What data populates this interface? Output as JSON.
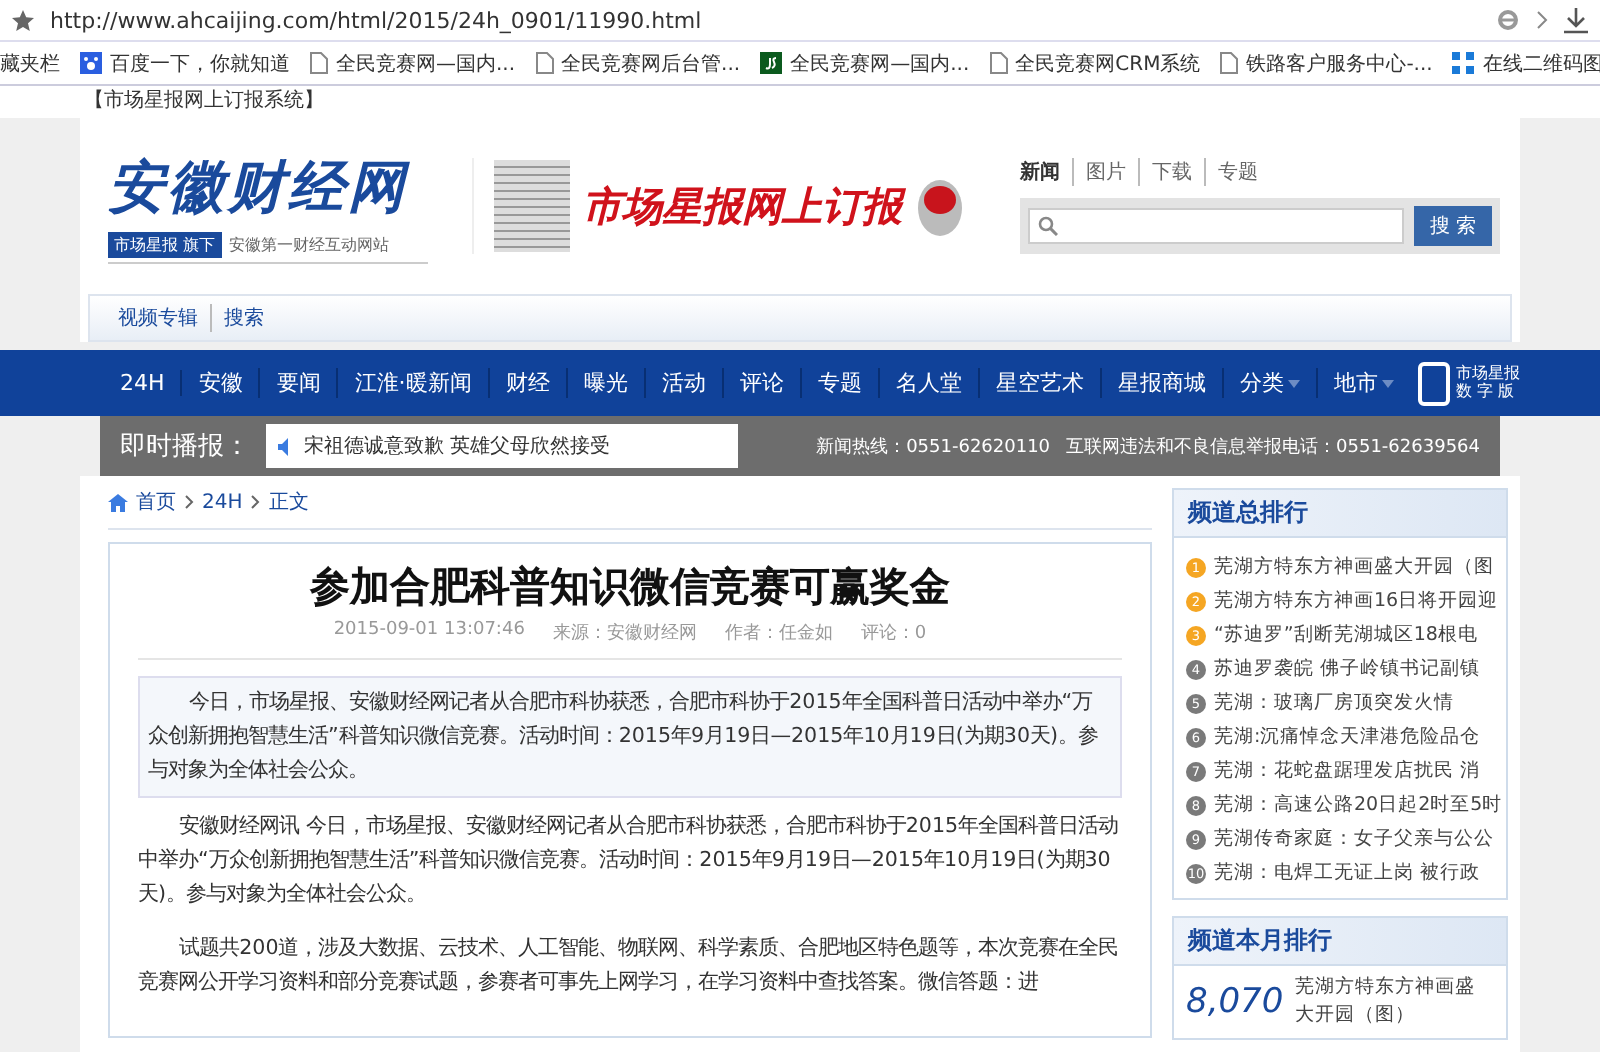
{
  "browser": {
    "url": "http://www.ahcaijing.com/html/2015/24h_0901/11990.html",
    "bookmarks": [
      {
        "label": "藏夹栏",
        "kind": "none"
      },
      {
        "label": "百度一下，你就知道",
        "kind": "paw"
      },
      {
        "label": "全民竞赛网—国内...",
        "kind": "page"
      },
      {
        "label": "全民竞赛网后台管...",
        "kind": "page"
      },
      {
        "label": "全民竞赛网—国内...",
        "kind": "js"
      },
      {
        "label": "全民竞赛网CRM系统",
        "kind": "page"
      },
      {
        "label": "铁路客户服务中心-...",
        "kind": "page"
      },
      {
        "label": "在线二维码图",
        "kind": "grid"
      }
    ]
  },
  "top_link": "【市场星报网上订报系统】",
  "header": {
    "logo": "安徽财经网",
    "logo_badge": "市场星报",
    "logo_badge_suffix": "旗下",
    "tagline": "安徽第一财经互动网站",
    "banner": "市场星报网上订报",
    "search_tabs": [
      {
        "label": "新闻",
        "selected": true
      },
      {
        "label": "图片",
        "selected": false
      },
      {
        "label": "下载",
        "selected": false
      },
      {
        "label": "专题",
        "selected": false
      }
    ],
    "search_button": "搜 索",
    "sub_links": [
      "视频专辑",
      "搜索"
    ]
  },
  "nav": {
    "items": [
      {
        "label": "24H",
        "dropdown": false
      },
      {
        "label": "安徽",
        "dropdown": false
      },
      {
        "label": "要闻",
        "dropdown": false
      },
      {
        "label": "江淮·暖新闻",
        "dropdown": false
      },
      {
        "label": "财经",
        "dropdown": false
      },
      {
        "label": "曝光",
        "dropdown": false
      },
      {
        "label": "活动",
        "dropdown": false
      },
      {
        "label": "评论",
        "dropdown": false
      },
      {
        "label": "专题",
        "dropdown": false
      },
      {
        "label": "名人堂",
        "dropdown": false
      },
      {
        "label": "星空艺术",
        "dropdown": false
      },
      {
        "label": "星报商城",
        "dropdown": false
      },
      {
        "label": "分类",
        "dropdown": true
      },
      {
        "label": "地市",
        "dropdown": true
      }
    ],
    "digital": [
      "市场星报",
      "数 字 版"
    ]
  },
  "ticker": {
    "label": "即时播报：",
    "headline": "宋祖德诚意致歉 英雄父母欣然接受",
    "hotline": "新闻热线：0551-62620110",
    "report": "互联网违法和不良信息举报电话：0551-62639564"
  },
  "breadcrumb": [
    "首页",
    "24H",
    "正文"
  ],
  "article": {
    "title": "参加合肥科普知识微信竞赛可赢奖金",
    "date": "2015-09-01 13:07:46",
    "source": "来源：安徽财经网",
    "author": "作者：任金如",
    "comments": "评论：0",
    "summary": "今日，市场星报、安徽财经网记者从合肥市科协获悉，合肥市科协于2015年全国科普日活动中举办“万众创新拥抱智慧生活”科普知识微信竞赛。活动时间：2015年9月19日—2015年10月19日(为期30天)。参与对象为全体社会公众。",
    "paragraphs": [
      "安徽财经网讯 今日，市场星报、安徽财经网记者从合肥市科协获悉，合肥市科协于2015年全国科普日活动中举办“万众创新拥抱智慧生活”科普知识微信竞赛。活动时间：2015年9月19日—2015年10月19日(为期30天)。参与对象为全体社会公众。",
      "试题共200道，涉及大数据、云技术、人工智能、物联网、科学素质、合肥地区特色题等，本次竞赛在全民竞赛网公开学习资料和部分竞赛试题，参赛者可事先上网学习，在学习资料中查找答案。微信答题：进"
    ]
  },
  "sidebar": {
    "ranking_title": "频道总排行",
    "ranking": [
      {
        "rank": "1",
        "title": "芜湖方特东方神画盛大开园（图",
        "color": "#f5a623"
      },
      {
        "rank": "2",
        "title": "芜湖方特东方神画16日将开园迎",
        "color": "#f5a623"
      },
      {
        "rank": "3",
        "title": "“苏迪罗”刮断芜湖城区18根电",
        "color": "#f5a623"
      },
      {
        "rank": "4",
        "title": "苏迪罗袭皖 佛子岭镇书记副镇",
        "color": "#7a7a7a"
      },
      {
        "rank": "5",
        "title": "芜湖：玻璃厂房顶突发火情",
        "color": "#7a7a7a"
      },
      {
        "rank": "6",
        "title": "芜湖:沉痛悼念天津港危险品仓",
        "color": "#7a7a7a"
      },
      {
        "rank": "7",
        "title": "芜湖：花蛇盘踞理发店扰民 消",
        "color": "#7a7a7a"
      },
      {
        "rank": "8",
        "title": "芜湖：高速公路20日起2时至5时",
        "color": "#7a7a7a"
      },
      {
        "rank": "9",
        "title": "芜湖传奇家庭：女子父亲与公公",
        "color": "#7a7a7a"
      },
      {
        "rank": "10",
        "title": "芜湖：电焊工无证上岗 被行政",
        "color": "#7a7a7a"
      }
    ],
    "monthly_title": "频道本月排行",
    "monthly": [
      {
        "count": "8,070",
        "title": "芜湖方特东方神画盛大开园（图）"
      }
    ]
  }
}
